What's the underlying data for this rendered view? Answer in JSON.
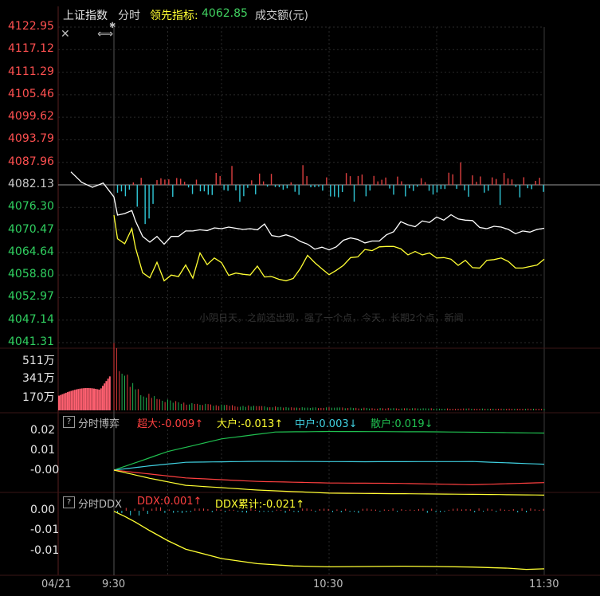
{
  "header": {
    "index_name": "上证指数",
    "mode": "分时",
    "leading_label": "领先指标:",
    "leading_value": "4062.85",
    "turnover_label": "成交额(元)"
  },
  "ghost_text": "小阴日天，之前还出现，强了一个点，今天，长期2个点，新闻",
  "x_labels": [
    "04/21",
    "9:30",
    "10:30",
    "11:30"
  ],
  "colors": {
    "up": "#ff4040",
    "down": "#20c050",
    "price_line": "#ffffff",
    "leading_line": "#ffff33",
    "flat": "#c8c8c8",
    "cyan": "#40d0e0"
  },
  "chart_data": [
    {
      "type": "line",
      "panel": "price",
      "y_ticks": [
        "4122.95",
        "4117.12",
        "4111.29",
        "4105.46",
        "4099.62",
        "4093.79",
        "4087.96",
        "4082.13",
        "4076.30",
        "4070.47",
        "4064.64",
        "4058.80",
        "4052.97",
        "4047.14",
        "4041.31"
      ],
      "ylim": [
        4041.31,
        4122.95
      ],
      "prev_close": 4082.13,
      "x_range_minutes": [
        -12,
        120
      ],
      "series": [
        {
          "name": "上证指数",
          "color": "#ffffff",
          "points": [
            [
              -12,
              4085.5
            ],
            [
              -9,
              4082.8
            ],
            [
              -6,
              4081.5
            ],
            [
              -3,
              4082.6
            ],
            [
              0,
              4079
            ],
            [
              1,
              4074.3
            ],
            [
              3,
              4074.7
            ],
            [
              5,
              4075.5
            ],
            [
              6,
              4072.8
            ],
            [
              8,
              4068.8
            ],
            [
              10,
              4067.3
            ],
            [
              12,
              4068.8
            ],
            [
              14,
              4066.8
            ],
            [
              16,
              4068.8
            ],
            [
              18,
              4068.8
            ],
            [
              20,
              4070.2
            ],
            [
              22,
              4070.2
            ],
            [
              24,
              4070.5
            ],
            [
              26,
              4070.3
            ],
            [
              28,
              4071.0
            ],
            [
              30,
              4070.8
            ],
            [
              32,
              4071.2
            ],
            [
              34,
              4070.9
            ],
            [
              36,
              4070.6
            ],
            [
              38,
              4070.8
            ],
            [
              40,
              4070.5
            ],
            [
              42,
              4072.0
            ],
            [
              44,
              4069.0
            ],
            [
              46,
              4068.7
            ],
            [
              48,
              4069.2
            ],
            [
              50,
              4068.6
            ],
            [
              52,
              4067.5
            ],
            [
              54,
              4066.8
            ],
            [
              56,
              4065.5
            ],
            [
              58,
              4066.0
            ],
            [
              60,
              4065.3
            ],
            [
              62,
              4066.1
            ],
            [
              64,
              4067.8
            ],
            [
              66,
              4068.4
            ],
            [
              68,
              4068.0
            ],
            [
              70,
              4067.1
            ],
            [
              72,
              4067.6
            ],
            [
              74,
              4067.6
            ],
            [
              76,
              4069.2
            ],
            [
              78,
              4070.0
            ],
            [
              80,
              4072.6
            ],
            [
              82,
              4071.8
            ],
            [
              84,
              4071.3
            ],
            [
              86,
              4072.8
            ],
            [
              88,
              4072.4
            ],
            [
              90,
              4073.8
            ],
            [
              92,
              4073.0
            ],
            [
              94,
              4074.4
            ],
            [
              96,
              4073.3
            ],
            [
              98,
              4073.0
            ],
            [
              100,
              4072.9
            ],
            [
              102,
              4071.1
            ],
            [
              104,
              4070.8
            ],
            [
              106,
              4071.4
            ],
            [
              108,
              4071.2
            ],
            [
              110,
              4070.6
            ],
            [
              112,
              4069.5
            ],
            [
              114,
              4070.2
            ],
            [
              116,
              4069.9
            ],
            [
              118,
              4070.6
            ],
            [
              120,
              4070.9
            ]
          ]
        },
        {
          "name": "领先指标",
          "color": "#ffff33",
          "points": [
            [
              0,
              4074.3
            ],
            [
              1,
              4068.2
            ],
            [
              3,
              4066.9
            ],
            [
              5,
              4070.8
            ],
            [
              6,
              4065.9
            ],
            [
              8,
              4059.4
            ],
            [
              10,
              4058.1
            ],
            [
              12,
              4062.1
            ],
            [
              14,
              4057.3
            ],
            [
              16,
              4058.8
            ],
            [
              18,
              4058.4
            ],
            [
              20,
              4061.4
            ],
            [
              22,
              4058.0
            ],
            [
              24,
              4064.5
            ],
            [
              26,
              4061.5
            ],
            [
              28,
              4063.2
            ],
            [
              30,
              4062.0
            ],
            [
              32,
              4058.7
            ],
            [
              34,
              4059.3
            ],
            [
              36,
              4059.0
            ],
            [
              38,
              4058.8
            ],
            [
              40,
              4061.1
            ],
            [
              42,
              4058.3
            ],
            [
              44,
              4058.4
            ],
            [
              46,
              4057.7
            ],
            [
              48,
              4057.3
            ],
            [
              50,
              4057.9
            ],
            [
              52,
              4060.5
            ],
            [
              54,
              4063.9
            ],
            [
              56,
              4062.0
            ],
            [
              58,
              4060.4
            ],
            [
              60,
              4058.9
            ],
            [
              62,
              4060.0
            ],
            [
              64,
              4061.3
            ],
            [
              66,
              4063.3
            ],
            [
              68,
              4063.5
            ],
            [
              70,
              4065.4
            ],
            [
              72,
              4065.1
            ],
            [
              74,
              4066.1
            ],
            [
              76,
              4066.2
            ],
            [
              78,
              4066.2
            ],
            [
              80,
              4065.6
            ],
            [
              82,
              4064.0
            ],
            [
              84,
              4064.9
            ],
            [
              86,
              4064.0
            ],
            [
              88,
              4064.5
            ],
            [
              90,
              4063.2
            ],
            [
              92,
              4063.3
            ],
            [
              94,
              4062.9
            ],
            [
              96,
              4061.3
            ],
            [
              98,
              4062.6
            ],
            [
              100,
              4060.7
            ],
            [
              102,
              4060.6
            ],
            [
              104,
              4062.6
            ],
            [
              106,
              4062.8
            ],
            [
              108,
              4063.2
            ],
            [
              110,
              4062.3
            ],
            [
              112,
              4060.6
            ],
            [
              114,
              4060.6
            ],
            [
              116,
              4061.0
            ],
            [
              118,
              4061.4
            ],
            [
              120,
              4062.9
            ]
          ]
        }
      ]
    },
    {
      "type": "bar",
      "panel": "turnover",
      "y_ticks": [
        "511万",
        "341万",
        "170万"
      ],
      "ylim": [
        0,
        511
      ],
      "unit": "万"
    },
    {
      "type": "line",
      "panel": "分时博弈",
      "title": "分时博弈",
      "y_ticks": [
        "0.02",
        "0.01",
        "-0.00"
      ],
      "ylim": [
        -0.02,
        0.02
      ],
      "legend": [
        {
          "label": "超大:",
          "value": "-0.009",
          "arrow": "↑",
          "color": "#ff4040"
        },
        {
          "label": "大户:",
          "value": "-0.013",
          "arrow": "↑",
          "color": "#ffff33"
        },
        {
          "label": "中户:",
          "value": "0.003",
          "arrow": "↓",
          "color": "#40d0e0"
        },
        {
          "label": "散户:",
          "value": "0.019",
          "arrow": "↓",
          "color": "#20c050"
        }
      ],
      "series": [
        {
          "name": "散户",
          "color": "#20c050",
          "points": [
            [
              0,
              0
            ],
            [
              15,
              0.0095
            ],
            [
              30,
              0.016
            ],
            [
              45,
              0.0195
            ],
            [
              60,
              0.0198
            ],
            [
              90,
              0.0196
            ],
            [
              120,
              0.019
            ]
          ]
        },
        {
          "name": "中户",
          "color": "#40d0e0",
          "points": [
            [
              0,
              0
            ],
            [
              10,
              0.0022
            ],
            [
              20,
              0.004
            ],
            [
              40,
              0.0045
            ],
            [
              70,
              0.0043
            ],
            [
              100,
              0.0044
            ],
            [
              120,
              0.003
            ]
          ]
        },
        {
          "name": "超大",
          "color": "#ff4040",
          "points": [
            [
              0,
              0
            ],
            [
              10,
              -0.002
            ],
            [
              20,
              -0.004
            ],
            [
              40,
              -0.0058
            ],
            [
              60,
              -0.0066
            ],
            [
              80,
              -0.0068
            ],
            [
              100,
              -0.0075
            ],
            [
              120,
              -0.0064
            ]
          ]
        },
        {
          "name": "大户",
          "color": "#ffff33",
          "points": [
            [
              0,
              0
            ],
            [
              10,
              -0.0042
            ],
            [
              20,
              -0.0078
            ],
            [
              40,
              -0.0102
            ],
            [
              60,
              -0.0118
            ],
            [
              80,
              -0.0121
            ],
            [
              100,
              -0.0124
            ],
            [
              120,
              -0.0128
            ]
          ]
        }
      ]
    },
    {
      "type": "line",
      "panel": "分时DDX",
      "title": "分时DDX",
      "y_ticks": [
        "0.00",
        "-0.01",
        "-0.01"
      ],
      "ylim": [
        -0.022,
        0.0
      ],
      "legend": [
        {
          "label": "DDX:",
          "value": "0.001",
          "arrow": "↑",
          "color": "#ff4040"
        },
        {
          "label": "DDX累计:",
          "value": "-0.021",
          "arrow": "↑",
          "color": "#ffff33"
        }
      ],
      "series": [
        {
          "name": "DDX累计",
          "color": "#ffff33",
          "points": [
            [
              0,
              -0.0002
            ],
            [
              3,
              -0.002
            ],
            [
              6,
              -0.004
            ],
            [
              10,
              -0.007
            ],
            [
              15,
              -0.0105
            ],
            [
              20,
              -0.0135
            ],
            [
              30,
              -0.0168
            ],
            [
              40,
              -0.0186
            ],
            [
              50,
              -0.0194
            ],
            [
              60,
              -0.0197
            ],
            [
              70,
              -0.0196
            ],
            [
              80,
              -0.0195
            ],
            [
              90,
              -0.0196
            ],
            [
              100,
              -0.0198
            ],
            [
              110,
              -0.0202
            ],
            [
              115,
              -0.0206
            ],
            [
              120,
              -0.0204
            ]
          ]
        }
      ]
    }
  ]
}
